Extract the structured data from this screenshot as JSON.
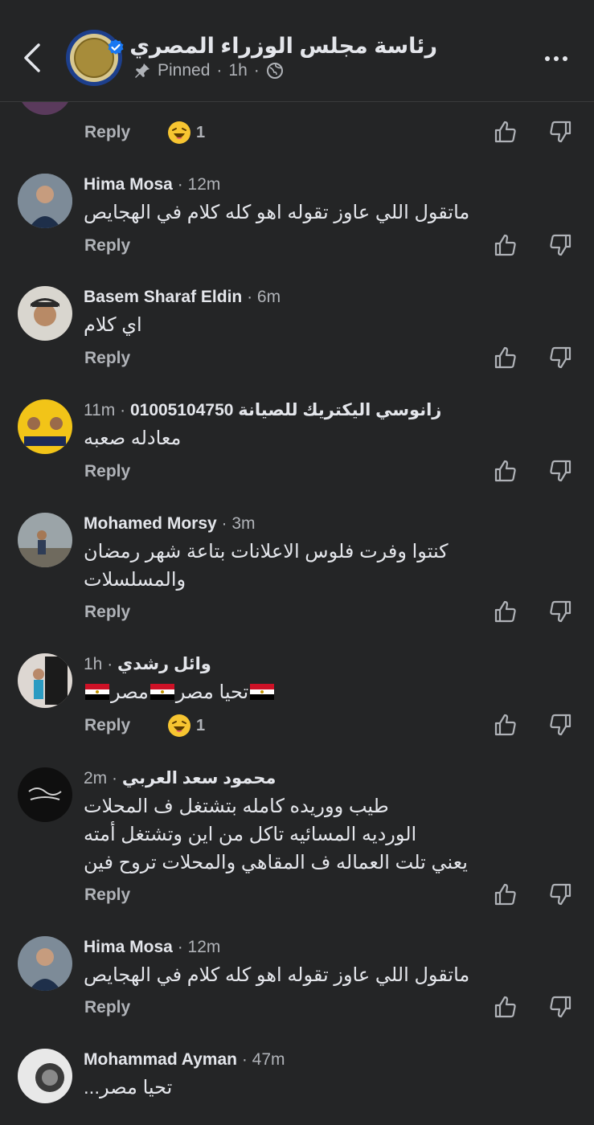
{
  "header": {
    "title": "رئاسة مجلس الوزراء المصري",
    "pinned": "Pinned",
    "sep": "·",
    "time": "1h"
  },
  "top_partial": {
    "reply": "Reply",
    "reaction_count": "1"
  },
  "comments": [
    {
      "name": "Hima Mosa",
      "time": "· 12m",
      "lines": [
        "ماتقول اللي عاوز تقوله اهو كله كلام في الهجايص"
      ],
      "reply": "Reply"
    },
    {
      "name": "Basem Sharaf Eldin",
      "time": "· 6m",
      "lines": [
        "اي كلام"
      ],
      "reply": "Reply"
    },
    {
      "name": "زانوسي اليكتريك للصيانة 01005104750",
      "time": "11m ·",
      "lines": [
        "معادله صعبه"
      ],
      "reply": "Reply"
    },
    {
      "name": "Mohamed Morsy",
      "time": "· 3m",
      "lines": [
        "كنتوا وفرت فلوس الاعلانات بتاعة شهر رمضان",
        "والمسلسلات"
      ],
      "reply": "Reply"
    },
    {
      "name": "وائل رشدي",
      "time": "1h ·",
      "lines": [
        "مصر",
        "تحيا مصر"
      ],
      "reply": "Reply",
      "reaction_count": "1"
    },
    {
      "name": "محمود سعد العربي",
      "time": "2m ·",
      "lines": [
        "طيب ووريده كامله بتشتغل ف المحلات",
        "الورديه المسائيه تاكل من اين وتشتغل أمته",
        "يعني تلت العماله ف المقاهي والمحلات تروح فين"
      ],
      "reply": "Reply"
    },
    {
      "name": "Hima Mosa",
      "time": "· 12m",
      "lines": [
        "ماتقول اللي عاوز تقوله اهو كله كلام في الهجايص"
      ],
      "reply": "Reply"
    },
    {
      "name": "Mohammad Ayman",
      "time": "· 47m",
      "lines": [
        "تحيا مصر..."
      ]
    }
  ],
  "colors": {
    "background": "#242526",
    "text": "#e4e6eb",
    "secondary": "#b0b3b8",
    "verified": "#1877f2"
  },
  "icons": {
    "back": "chevron-left-icon",
    "verified": "verified-badge-icon",
    "pin": "pin-icon",
    "globe": "globe-icon",
    "more": "more-dots-icon",
    "like": "thumbs-up-icon",
    "dislike": "thumbs-down-icon",
    "reaction": "haha-emoji-icon",
    "flag": "egypt-flag-icon"
  }
}
